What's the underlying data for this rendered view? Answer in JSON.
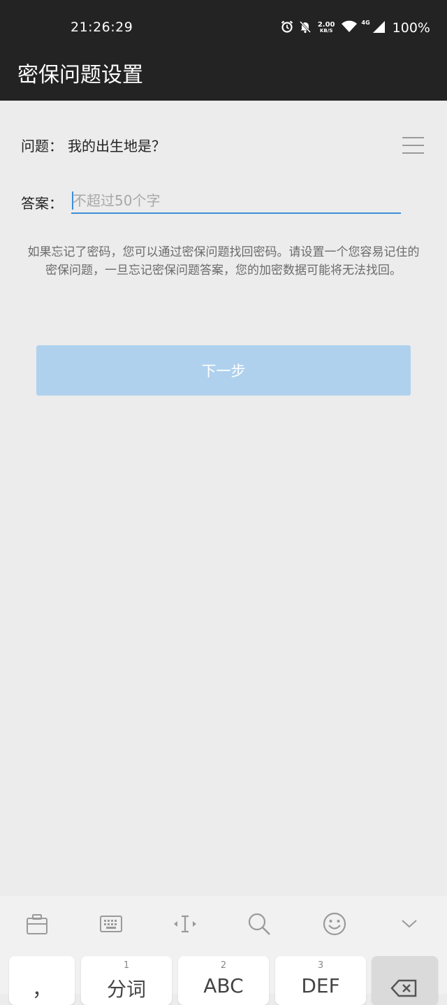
{
  "status_bar": {
    "time": "21:26:29",
    "net_speed": "2.00",
    "net_speed_unit": "KB/S",
    "network_type": "4G",
    "battery": "100%",
    "icons": [
      "alarm-icon",
      "bell-off-icon",
      "wifi-icon",
      "signal-icon"
    ]
  },
  "app_bar": {
    "title": "密保问题设置"
  },
  "form": {
    "question_label": "问题：",
    "question_value": "我的出生地是？",
    "answer_label": "答案：",
    "answer_value": "",
    "answer_placeholder": "不超过50个字"
  },
  "hint": "如果忘记了密码，您可以通过密保问题找回密码。请设置一个您容易记住的密保问题，一旦忘记密保问题答案，您的加密数据可能将无法找回。",
  "next_button": "下一步",
  "colors": {
    "bar_bg": "#232323",
    "accent": "#3d8fd6",
    "button_disabled": "#afd1ee",
    "page_bg": "#ececec"
  },
  "keyboard": {
    "toolbar_icons": [
      "clipboard-icon",
      "keyboard-icon",
      "cursor-icon",
      "search-icon",
      "emoji-icon",
      "collapse-icon"
    ],
    "keys": [
      {
        "num": "",
        "label": "，"
      },
      {
        "num": "1",
        "label": "分词"
      },
      {
        "num": "2",
        "label": "ABC"
      },
      {
        "num": "3",
        "label": "DEF"
      }
    ],
    "delete_icon": "backspace-icon"
  }
}
